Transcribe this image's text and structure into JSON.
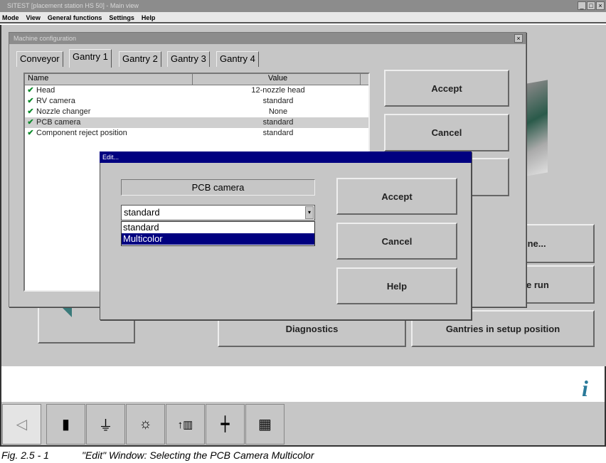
{
  "window": {
    "title": "SITEST [placement station HS 50] - Main view",
    "controls": [
      "_",
      "□",
      "×"
    ]
  },
  "menu": [
    "Mode",
    "View",
    "General functions",
    "Settings",
    "Help"
  ],
  "main_buttons": {
    "diagnostics": "Diagnostics",
    "gantries": "Gantries in setup position",
    "machine_partial": "ine...",
    "run_partial": "e run"
  },
  "config_dialog": {
    "title": "Machine configuration",
    "close": "×",
    "tabs": [
      "Conveyor",
      "Gantry 1",
      "Gantry 2",
      "Gantry 3",
      "Gantry 4"
    ],
    "active_tab": "Gantry 1",
    "columns": [
      "Name",
      "Value"
    ],
    "rows": [
      {
        "name": "Head",
        "value": "12-nozzle head"
      },
      {
        "name": "RV camera",
        "value": "standard"
      },
      {
        "name": "Nozzle changer",
        "value": "None"
      },
      {
        "name": "PCB camera",
        "value": "standard"
      },
      {
        "name": "Component reject position",
        "value": "standard"
      }
    ],
    "accept": "Accept",
    "cancel": "Cancel"
  },
  "edit_dialog": {
    "title": "Edit...",
    "label": "PCB camera",
    "combo_value": "standard",
    "options": [
      "standard",
      "Multicolor"
    ],
    "selected_option": "Multicolor",
    "accept": "Accept",
    "cancel": "Cancel",
    "help": "Help"
  },
  "toolbar": {
    "icons": [
      "back-arrow",
      "exclamation",
      "nozzle",
      "sun",
      "feeder-up",
      "crosshair",
      "grid"
    ],
    "glyphs": [
      "◁",
      "▮",
      "⏚",
      "☼",
      "↑▥",
      "┿",
      "▦"
    ]
  },
  "info_icon": "i",
  "caption": {
    "fig": "Fig. 2.5 - 1",
    "text": "\"Edit\" Window: Selecting the PCB Camera Multicolor"
  },
  "colors": {
    "titlebar": "#000080",
    "selection": "#000080",
    "check": "#0a8a2a"
  }
}
